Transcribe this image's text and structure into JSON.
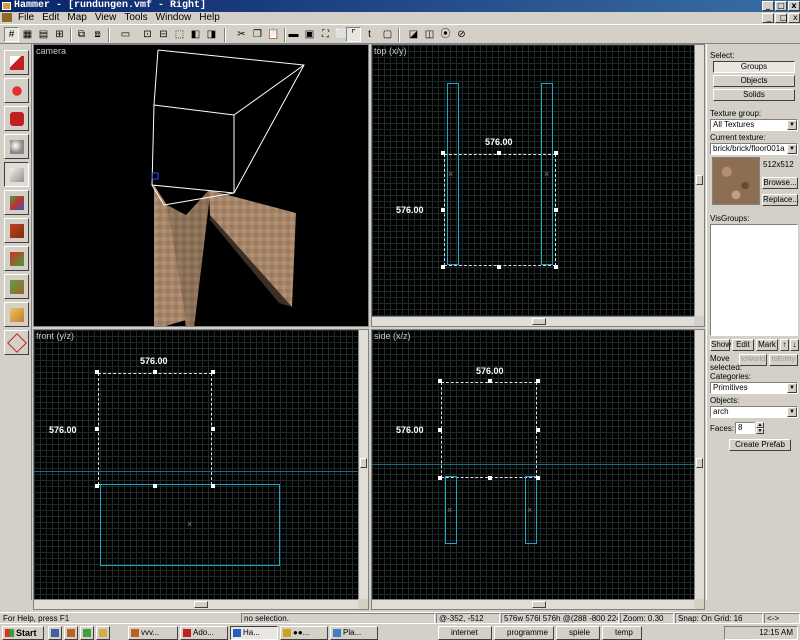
{
  "window": {
    "title": "Hammer - [rundungen.vmf - Right]",
    "minimize": "_",
    "maximize": "□",
    "close": "x"
  },
  "menu": [
    "File",
    "Edit",
    "Map",
    "View",
    "Tools",
    "Window",
    "Help"
  ],
  "viewports": {
    "camera": {
      "label": "camera"
    },
    "top": {
      "label": "top (x/y)",
      "width_label": "576.00",
      "height_label": "576.00"
    },
    "front": {
      "label": "front (y/z)",
      "width_label": "576.00",
      "height_label": "576.00"
    },
    "side": {
      "label": "side (x/z)",
      "width_label": "576.00",
      "height_label": "576.00"
    }
  },
  "panel": {
    "select_label": "Select:",
    "select_buttons": [
      "Groups",
      "Objects",
      "Solids"
    ],
    "texture_group_label": "Texture group:",
    "texture_group_value": "All Textures",
    "current_texture_label": "Current texture:",
    "current_texture_value": "brick/brick/floor001a",
    "texture_size": "512x512",
    "browse_label": "Browse...",
    "replace_label": "Replace...",
    "visgroups_label": "VisGroups:",
    "vis_buttons": [
      "Show",
      "Edit",
      "Mark"
    ],
    "move_selected_label": "Move selected:",
    "to_world_label": "toWorld",
    "to_entity_label": "toEntity",
    "categories_label": "Categories:",
    "categories_value": "Primitives",
    "objects_label": "Objects:",
    "objects_value": "arch",
    "faces_label": "Faces:",
    "faces_value": "8",
    "create_prefab_label": "Create Prefab"
  },
  "status": {
    "help": "For Help, press F1",
    "selection": "no selection.",
    "coords": "@-352, -512",
    "size": "576w 576l 576h @(288 -800 224)",
    "zoom": "Zoom: 0.30",
    "snap": "Snap: On Grid: 16",
    "extra": "<->"
  },
  "taskbar": {
    "start": "Start",
    "tasks": [
      "vvv...",
      "Ado...",
      "Ha...",
      "●●...",
      "Pla..."
    ],
    "folders": [
      "internet",
      "programme",
      "spiele",
      "temp"
    ],
    "clock": "12:15 AM"
  },
  "colors": {
    "selection_cyan": "#1aa7c8",
    "grid_dark": "#1e2a2a",
    "grid_major": "#2c3c3c",
    "titlebar": "#0a246a"
  }
}
